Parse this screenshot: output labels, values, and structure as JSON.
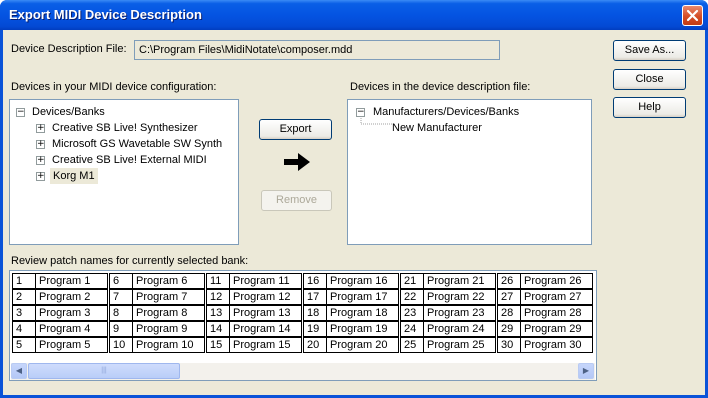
{
  "window": {
    "title": "Export MIDI Device Description"
  },
  "file": {
    "label": "Device Description File:",
    "path": "C:\\Program Files\\MidiNotate\\composer.mdd"
  },
  "buttons": {
    "save_as": "Save As...",
    "close": "Close",
    "help": "Help",
    "export": "Export",
    "remove": "Remove"
  },
  "config_panel": {
    "label": "Devices in your MIDI device configuration:",
    "root": "Devices/Banks",
    "items": [
      "Creative SB Live! Synthesizer",
      "Microsoft GS Wavetable SW Synth",
      "Creative SB Live! External MIDI",
      "Korg M1"
    ]
  },
  "file_panel": {
    "label": "Devices in the device description file:",
    "root": "Manufacturers/Devices/Banks",
    "items": [
      "New Manufacturer"
    ]
  },
  "patches": {
    "label": "Review patch names for currently selected bank:",
    "columns": [
      [
        [
          "1",
          "Program 1"
        ],
        [
          "2",
          "Program 2"
        ],
        [
          "3",
          "Program 3"
        ],
        [
          "4",
          "Program 4"
        ],
        [
          "5",
          "Program 5"
        ]
      ],
      [
        [
          "6",
          "Program 6"
        ],
        [
          "7",
          "Program 7"
        ],
        [
          "8",
          "Program 8"
        ],
        [
          "9",
          "Program 9"
        ],
        [
          "10",
          "Program 10"
        ]
      ],
      [
        [
          "11",
          "Program 11"
        ],
        [
          "12",
          "Program 12"
        ],
        [
          "13",
          "Program 13"
        ],
        [
          "14",
          "Program 14"
        ],
        [
          "15",
          "Program 15"
        ]
      ],
      [
        [
          "16",
          "Program 16"
        ],
        [
          "17",
          "Program 17"
        ],
        [
          "18",
          "Program 18"
        ],
        [
          "19",
          "Program 19"
        ],
        [
          "20",
          "Program 20"
        ]
      ],
      [
        [
          "21",
          "Program 21"
        ],
        [
          "22",
          "Program 22"
        ],
        [
          "23",
          "Program 23"
        ],
        [
          "24",
          "Program 24"
        ],
        [
          "25",
          "Program 25"
        ]
      ],
      [
        [
          "26",
          "Program 26"
        ],
        [
          "27",
          "Program 27"
        ],
        [
          "28",
          "Program 28"
        ],
        [
          "29",
          "Program 29"
        ],
        [
          "30",
          "Program 30"
        ]
      ]
    ]
  },
  "icons": {
    "close": "close-icon",
    "arrow": "right-arrow-icon",
    "expand": "plus-box-icon",
    "collapse": "minus-box-icon"
  },
  "colors": {
    "titlebar": "#0454e2",
    "dialog": "#ece9d8",
    "selection": "#ece9d8"
  }
}
